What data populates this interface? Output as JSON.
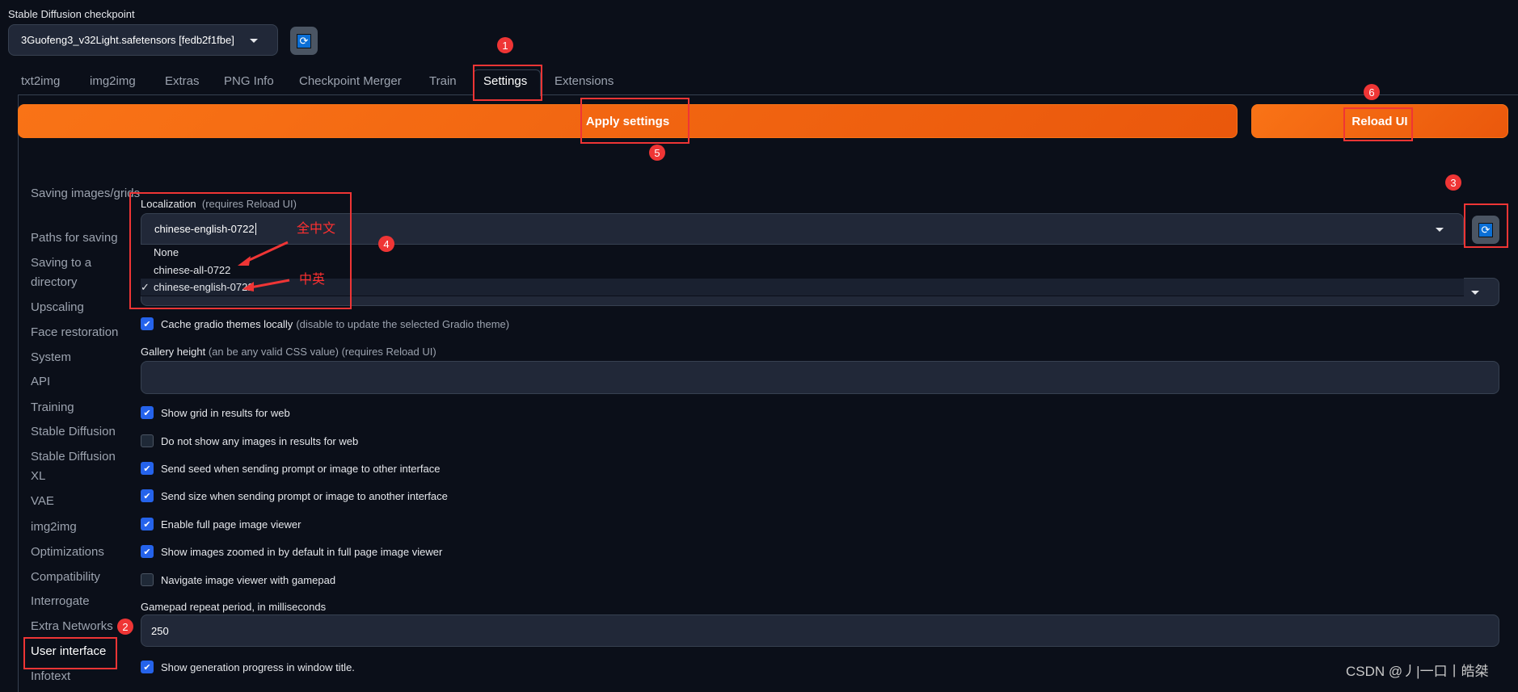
{
  "checkpoint": {
    "label": "Stable Diffusion checkpoint",
    "value": "3Guofeng3_v32Light.safetensors [fedb2f1fbe]"
  },
  "tabs": [
    "txt2img",
    "img2img",
    "Extras",
    "PNG Info",
    "Checkpoint Merger",
    "Train",
    "Settings",
    "Extensions"
  ],
  "active_tab": "Settings",
  "buttons": {
    "apply": "Apply settings",
    "reload": "Reload UI"
  },
  "sidebar": [
    "Saving images/grids",
    "Paths for saving",
    "Saving to a directory",
    "Upscaling",
    "Face restoration",
    "System",
    "API",
    "Training",
    "Stable Diffusion",
    "Stable Diffusion XL",
    "VAE",
    "img2img",
    "Optimizations",
    "Compatibility",
    "Interrogate",
    "Extra Networks",
    "User interface",
    "Infotext"
  ],
  "sidebar_active": "User interface",
  "localization": {
    "label": "Localization",
    "hint": "(requires Reload UI)",
    "value": "chinese-english-0722",
    "options": [
      "None",
      "chinese-all-0722",
      "chinese-english-0722"
    ],
    "selected_mark": "✓"
  },
  "settings": {
    "cache_themes": {
      "label": "Cache gradio themes locally",
      "hint": "(disable to update the selected Gradio theme)",
      "checked": true
    },
    "gallery_height": {
      "label": "Gallery height",
      "hint": "(an be any valid CSS value) (requires Reload UI)",
      "value": ""
    },
    "checkboxes": [
      {
        "label": "Show grid in results for web",
        "checked": true
      },
      {
        "label": "Do not show any images in results for web",
        "checked": false
      },
      {
        "label": "Send seed when sending prompt or image to other interface",
        "checked": true
      },
      {
        "label": "Send size when sending prompt or image to another interface",
        "checked": true
      },
      {
        "label": "Enable full page image viewer",
        "checked": true
      },
      {
        "label": "Show images zoomed in by default in full page image viewer",
        "checked": true
      },
      {
        "label": "Navigate image viewer with gamepad",
        "checked": false
      }
    ],
    "gamepad": {
      "label": "Gamepad repeat period, in milliseconds",
      "value": "250"
    },
    "progress_title": {
      "label": "Show generation progress in window title.",
      "checked": true
    }
  },
  "annotations": {
    "numbers": [
      "1",
      "2",
      "3",
      "4",
      "5",
      "6"
    ],
    "all_chinese": "全中文",
    "chinese_english": "中英",
    "color": "#ef3535"
  },
  "watermark": "CSDN @丿|一口丨皓桀",
  "colors": {
    "accent": "#f97316",
    "background": "#0b0f19",
    "checkbox": "#2563eb"
  }
}
